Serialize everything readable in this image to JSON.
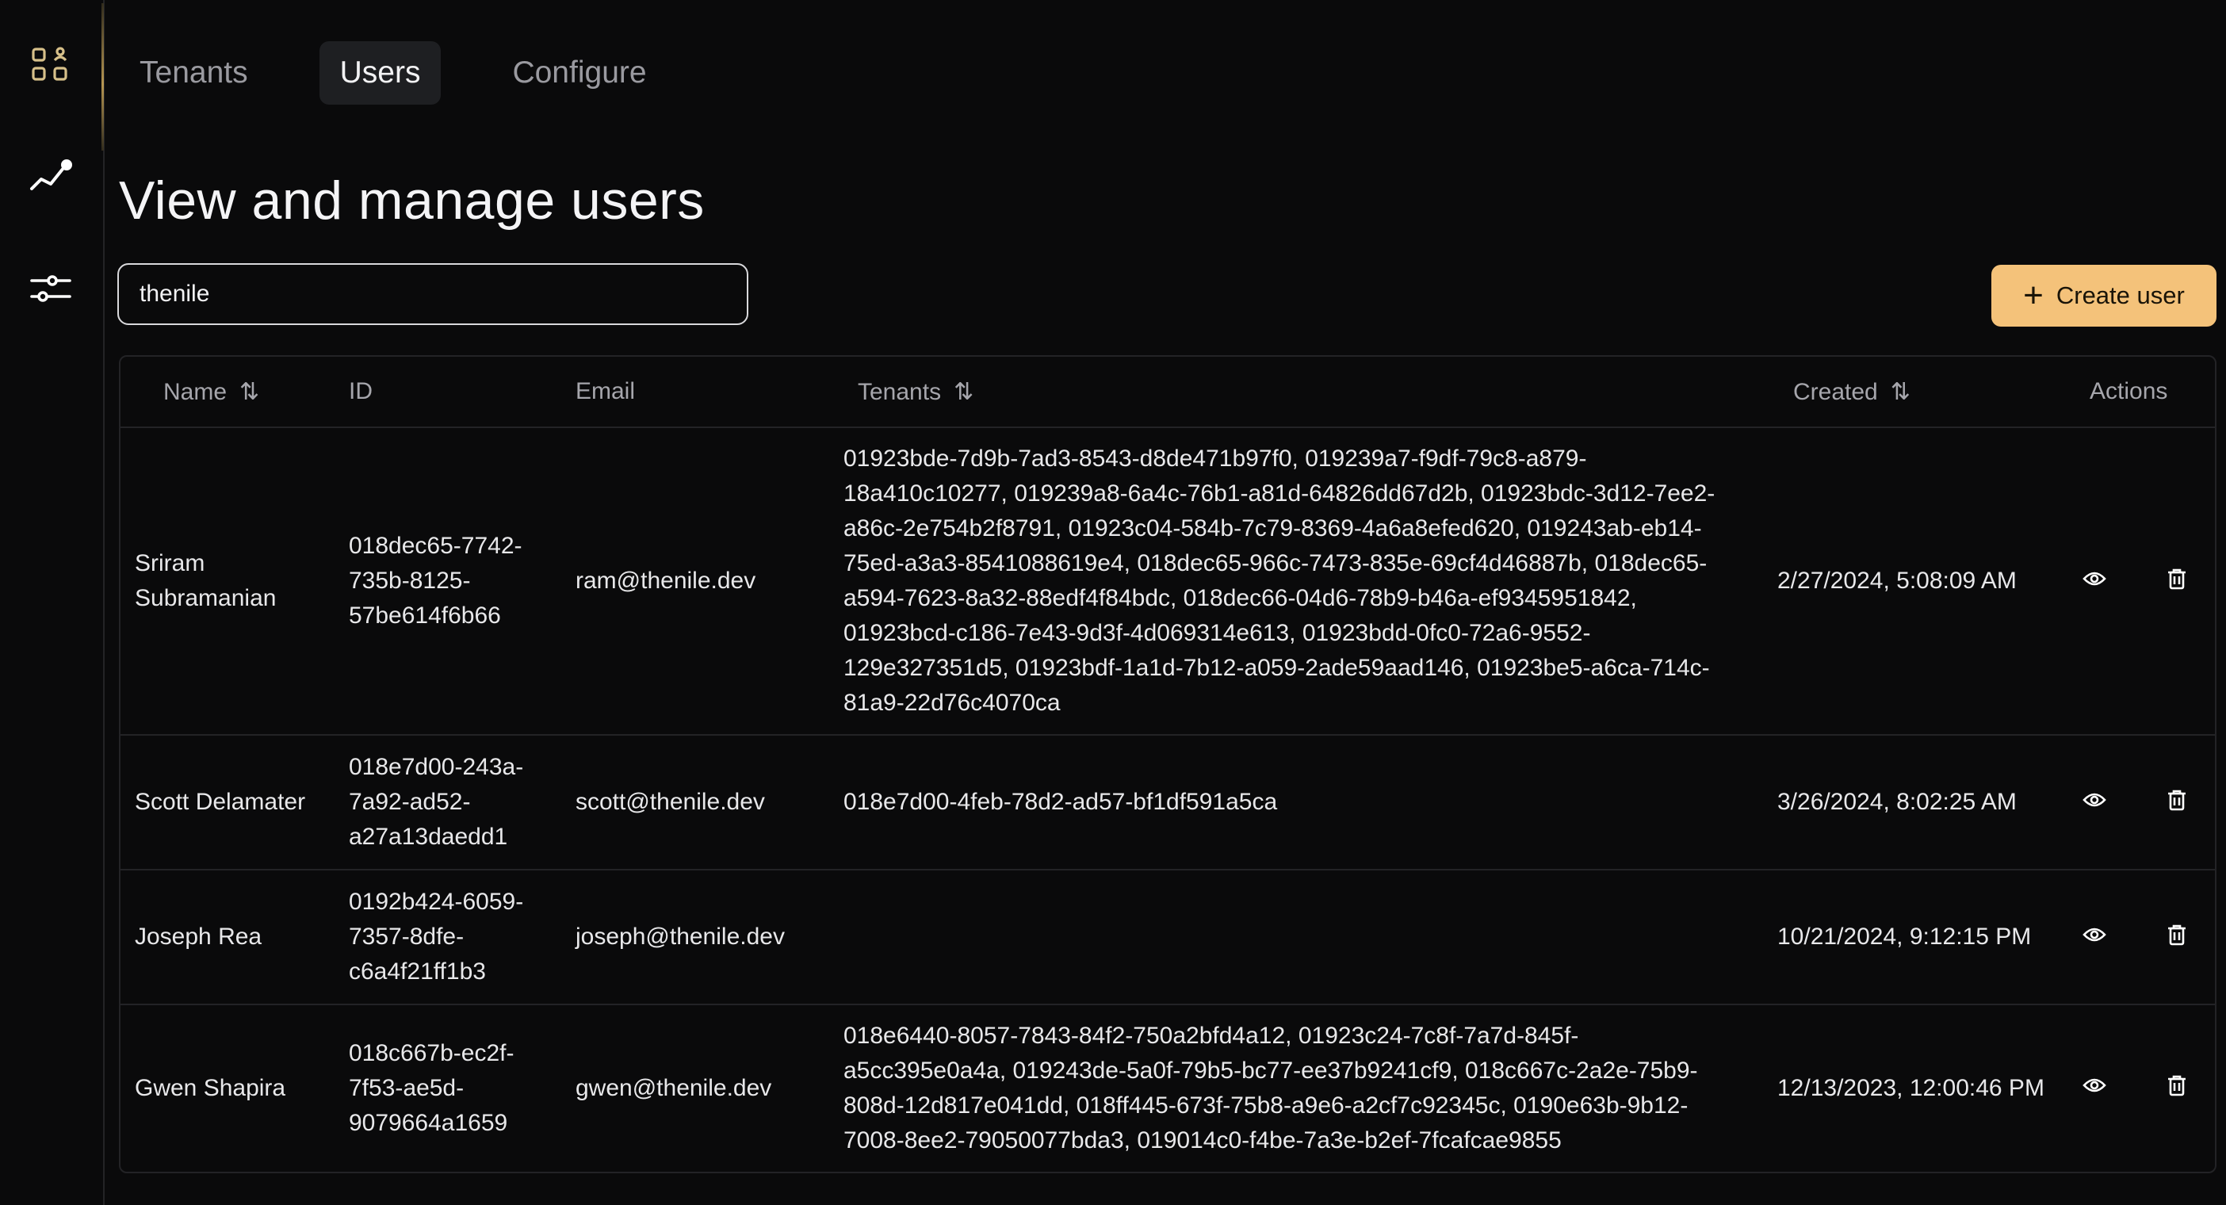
{
  "nav": {
    "items": [
      {
        "icon": "tenants-grid-icon"
      },
      {
        "icon": "analytics-chart-icon"
      },
      {
        "icon": "settings-sliders-icon"
      }
    ]
  },
  "tabs": [
    {
      "label": "Tenants",
      "active": false
    },
    {
      "label": "Users",
      "active": true
    },
    {
      "label": "Configure",
      "active": false
    }
  ],
  "page": {
    "title": "View and manage users"
  },
  "search": {
    "value": "thenile"
  },
  "create_button": {
    "label": "Create user",
    "icon": "plus-icon"
  },
  "colors": {
    "accent": "#f4c27a",
    "background": "#0a0a0b"
  },
  "table": {
    "columns": [
      "Name",
      "ID",
      "Email",
      "Tenants",
      "Created",
      "Actions"
    ],
    "sortable": [
      "Name",
      "Tenants",
      "Created"
    ],
    "rows": [
      {
        "name": "Sriram Subramanian",
        "id": "018dec65-7742-735b-8125-57be614f6b66",
        "email": "ram@thenile.dev",
        "tenants": "01923bde-7d9b-7ad3-8543-d8de471b97f0, 019239a7-f9df-79c8-a879-18a410c10277, 019239a8-6a4c-76b1-a81d-64826dd67d2b, 01923bdc-3d12-7ee2-a86c-2e754b2f8791, 01923c04-584b-7c79-8369-4a6a8efed620, 019243ab-eb14-75ed-a3a3-8541088619e4, 018dec65-966c-7473-835e-69cf4d46887b, 018dec65-a594-7623-8a32-88edf4f84bdc, 018dec66-04d6-78b9-b46a-ef9345951842, 01923bcd-c186-7e43-9d3f-4d069314e613, 01923bdd-0fc0-72a6-9552-129e327351d5, 01923bdf-1a1d-7b12-a059-2ade59aad146, 01923be5-a6ca-714c-81a9-22d76c4070ca",
        "created": "2/27/2024, 5:08:09 AM"
      },
      {
        "name": "Scott Delamater",
        "id": "018e7d00-243a-7a92-ad52-a27a13daedd1",
        "email": "scott@thenile.dev",
        "tenants": "018e7d00-4feb-78d2-ad57-bf1df591a5ca",
        "created": "3/26/2024, 8:02:25 AM"
      },
      {
        "name": "Joseph Rea",
        "id": "0192b424-6059-7357-8dfe-c6a4f21ff1b3",
        "email": "joseph@thenile.dev",
        "tenants": "",
        "created": "10/21/2024, 9:12:15 PM"
      },
      {
        "name": "Gwen Shapira",
        "id": "018c667b-ec2f-7f53-ae5d-9079664a1659",
        "email": "gwen@thenile.dev",
        "tenants": "018e6440-8057-7843-84f2-750a2bfd4a12, 01923c24-7c8f-7a7d-845f-a5cc395e0a4a, 019243de-5a0f-79b5-bc77-ee37b9241cf9, 018c667c-2a2e-75b9-808d-12d817e041dd, 018ff445-673f-75b8-a9e6-a2cf7c92345c, 0190e63b-9b12-7008-8ee2-79050077bda3, 019014c0-f4be-7a3e-b2ef-7fcafcae9855",
        "created": "12/13/2023, 12:00:46 PM"
      }
    ],
    "action_icons": [
      "view-eye-icon",
      "delete-trash-icon"
    ]
  }
}
